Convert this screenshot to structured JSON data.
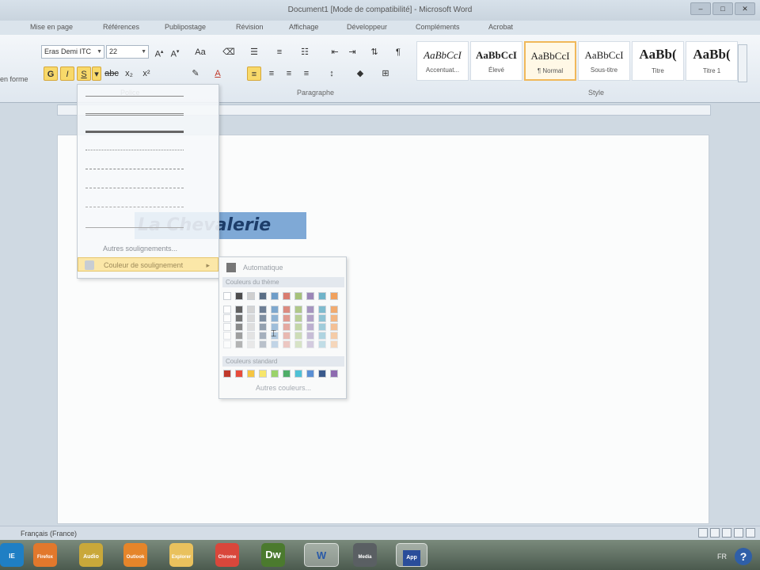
{
  "window": {
    "title": "Document1 [Mode de compatibilité] - Microsoft Word"
  },
  "tabs": [
    "Mise en page",
    "Références",
    "Publipostage",
    "Révision",
    "Affichage",
    "Développeur",
    "Compléments",
    "Acrobat"
  ],
  "ribbon": {
    "left_cut_label": "en forme",
    "font_name": "Eras Demi ITC",
    "font_size": "22",
    "groups": {
      "font": "Police",
      "paragraph": "Paragraphe",
      "style": "Style"
    },
    "styles": [
      {
        "sample": "AaBbCcI",
        "name": "Accentuat..."
      },
      {
        "sample": "AaBbCcI",
        "name": "Élevé"
      },
      {
        "sample": "AaBbCcI",
        "name": "¶ Normal"
      },
      {
        "sample": "AaBbCcI",
        "name": "Sous-titre"
      },
      {
        "sample": "AaBb(",
        "name": "Titre"
      },
      {
        "sample": "AaBb(",
        "name": "Titre 1"
      }
    ]
  },
  "document": {
    "text": "La Chevalerie"
  },
  "underline_menu": {
    "more_underlines": "Autres soulignements...",
    "underline_color": "Couleur de soulignement"
  },
  "color_palette": {
    "automatic": "Automatique",
    "theme_colors": "Couleurs du thème",
    "standard_colors": "Couleurs standard",
    "more_colors": "Autres couleurs...",
    "theme_top_row": [
      "#ffffff",
      "#4d4d4d",
      "#cfcfcf",
      "#5a6e86",
      "#6e9dc9",
      "#d97c70",
      "#a6c27a",
      "#9b86b7",
      "#6fb3c9",
      "#f0a15e"
    ],
    "standard_row": [
      "#c0392b",
      "#e74c3c",
      "#f5c542",
      "#f7e66b",
      "#9bd36a",
      "#4fae68",
      "#4fc1d6",
      "#5a8fd4",
      "#3a5a8c",
      "#8e6bb0"
    ]
  },
  "statusbar": {
    "language": "Français (France)"
  },
  "taskbar": {
    "apps": [
      "IE",
      "Firefox",
      "Audio",
      "Outlook",
      "Explorer",
      "Chrome",
      "Dw",
      "W",
      "Media",
      "App"
    ],
    "tray_lang": "FR"
  }
}
